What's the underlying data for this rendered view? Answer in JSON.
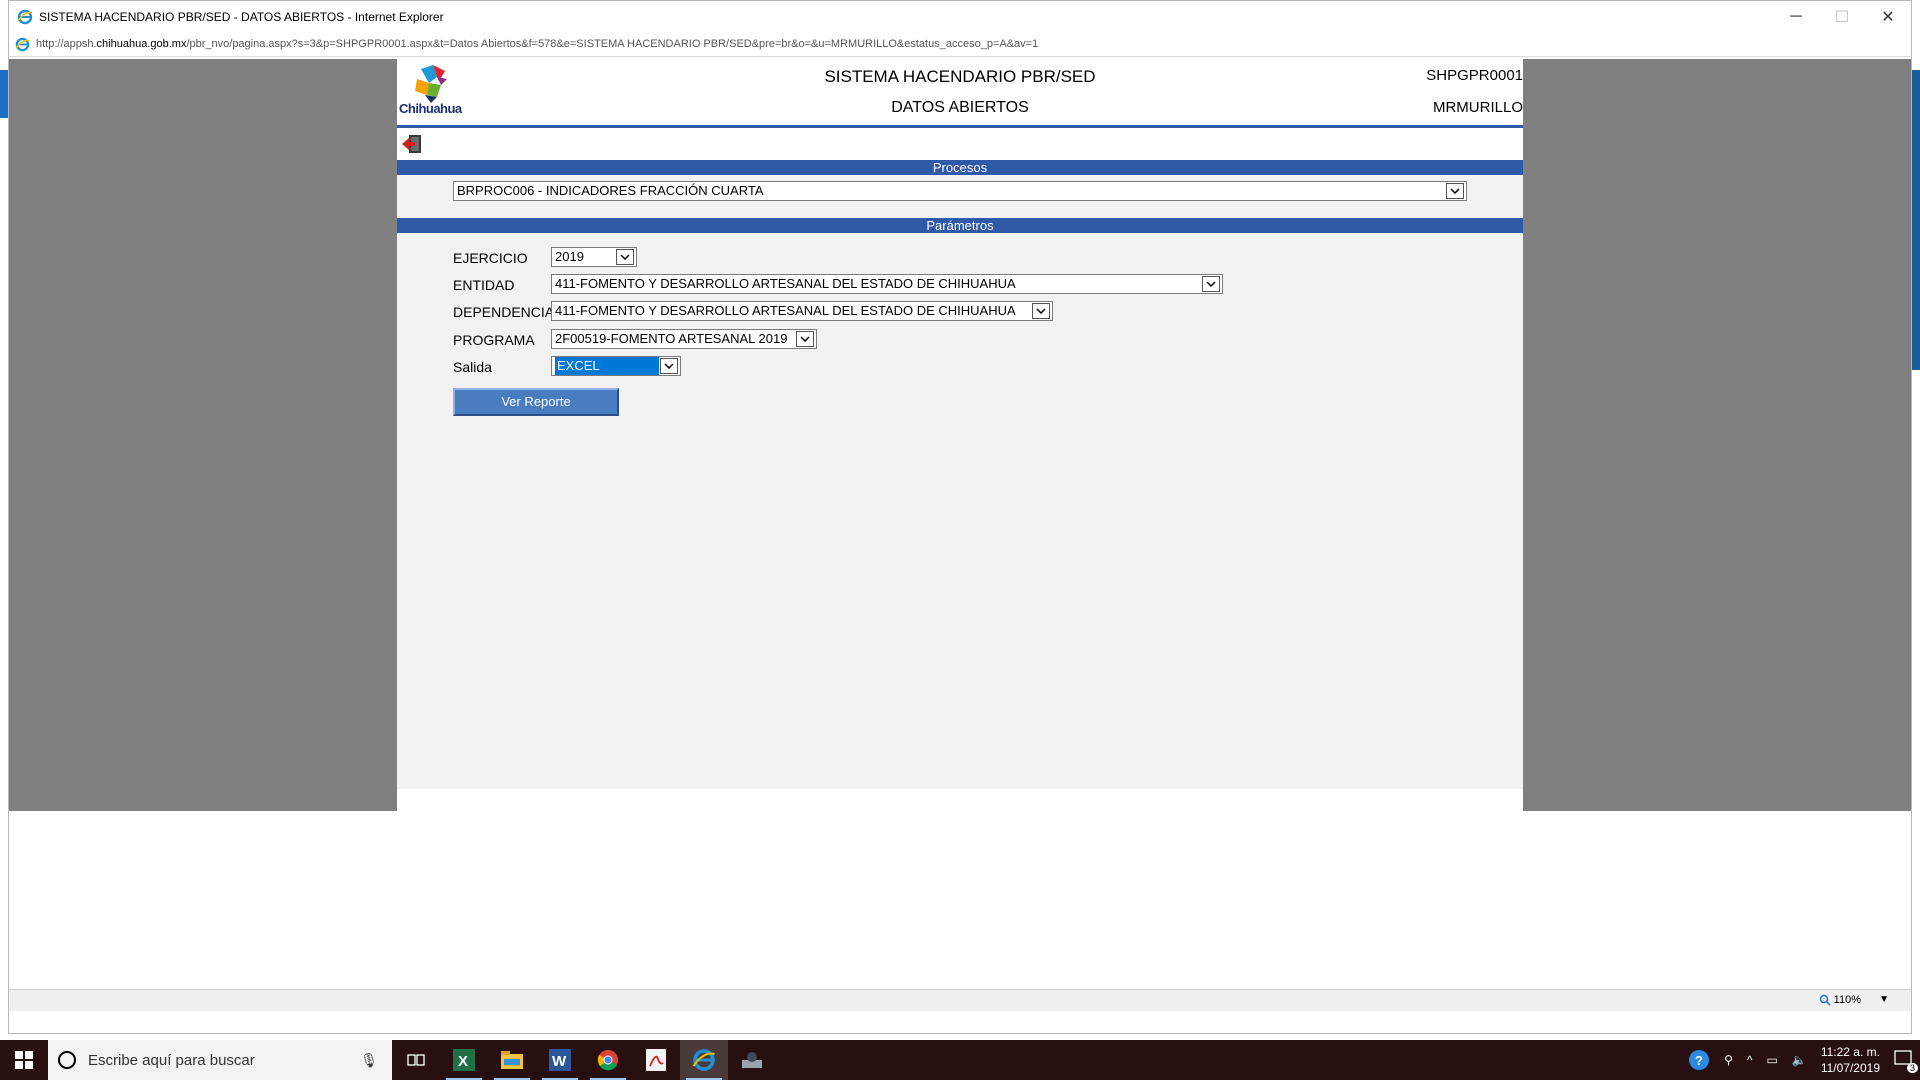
{
  "window": {
    "title": "SISTEMA HACENDARIO PBR/SED - DATOS ABIERTOS - Internet Explorer",
    "url_prefix": "http://appsh.",
    "url_domain": "chihuahua.gob.mx",
    "url_rest": "/pbr_nvo/pagina.aspx?s=3&p=SHPGPR0001.aspx&t=Datos Abiertos&f=578&e=SISTEMA HACENDARIO PBR/SED&pre=br&o=&u=MRMURILLO&estatus_acceso_p=A&av=1",
    "minimize": "─",
    "maximize": "☐",
    "close": "✕"
  },
  "header": {
    "logo_text": "Chihuahua",
    "title": "SISTEMA HACENDARIO PBR/SED",
    "subtitle": "DATOS ABIERTOS",
    "code": "SHPGPR0001",
    "user": "MRMURILLO"
  },
  "sections": {
    "procesos": "Procesos",
    "parametros": "Parámetros"
  },
  "process": {
    "selected": "BRPROC006 - INDICADORES FRACCIÓN CUARTA"
  },
  "params": {
    "ejercicio": {
      "label": "EJERCICIO",
      "value": "2019"
    },
    "entidad": {
      "label": "ENTIDAD",
      "value": "411-FOMENTO Y DESARROLLO ARTESANAL DEL ESTADO DE CHIHUAHUA"
    },
    "dependencia": {
      "label": "DEPENDENCIA",
      "value": "411-FOMENTO Y DESARROLLO ARTESANAL DEL ESTADO DE CHIHUAHUA"
    },
    "programa": {
      "label": "PROGRAMA",
      "value": "2F00519-FOMENTO ARTESANAL 2019"
    },
    "salida": {
      "label": "Salida",
      "value": "EXCEL"
    }
  },
  "report_button": "Ver Reporte",
  "status": {
    "zoom": "110%"
  },
  "taskbar": {
    "search_placeholder": "Escribe aquí para buscar",
    "time": "11:22 a. m.",
    "date": "11/07/2019",
    "notifications": "3"
  },
  "colors": {
    "accent_blue": "#2f5aa8",
    "button_blue": "#4a7cc0",
    "taskbar": "#281010",
    "gray_bg": "#808080"
  }
}
